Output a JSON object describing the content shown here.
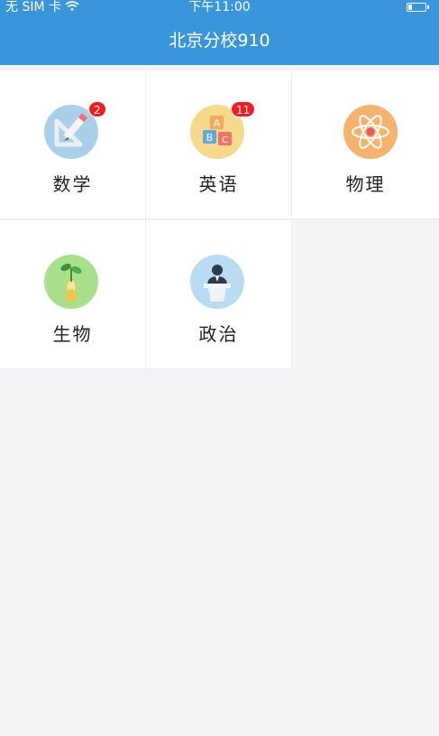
{
  "status_bar": {
    "carrier": "无 SIM 卡",
    "time": "下午11:00"
  },
  "nav": {
    "title": "北京分校910"
  },
  "subjects": [
    {
      "label": "数学",
      "badge": "2",
      "icon": "geometry-ruler-pencil-icon",
      "color": "#a9cfe9"
    },
    {
      "label": "英语",
      "badge": "11",
      "icon": "abc-blocks-icon",
      "color": "#f7d98c"
    },
    {
      "label": "物理",
      "badge": null,
      "icon": "atom-icon",
      "color": "#f6b36d"
    },
    {
      "label": "生物",
      "badge": null,
      "icon": "sprout-test-tube-icon",
      "color": "#a8e08c"
    },
    {
      "label": "政治",
      "badge": null,
      "icon": "speaker-podium-icon",
      "color": "#b9dcf3"
    }
  ],
  "colors": {
    "header": "#3a96da",
    "badge": "#f51b22",
    "background": "#f2f3f5"
  }
}
